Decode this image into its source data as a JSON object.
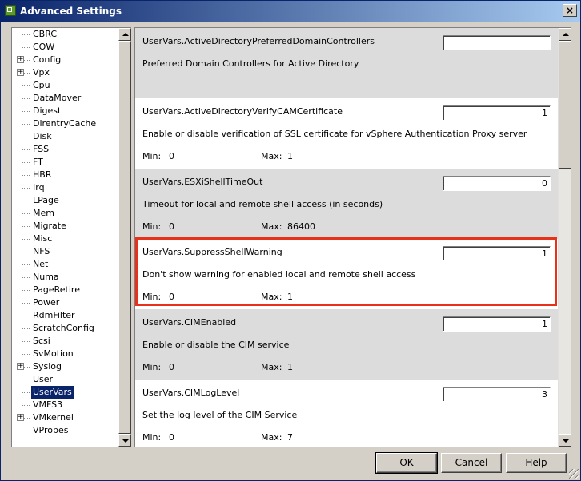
{
  "window": {
    "title": "Advanced Settings",
    "close_glyph": "×"
  },
  "tree": {
    "items": [
      {
        "label": "CBRC",
        "expandable": false
      },
      {
        "label": "COW",
        "expandable": false
      },
      {
        "label": "Config",
        "expandable": true
      },
      {
        "label": "Vpx",
        "expandable": true
      },
      {
        "label": "Cpu",
        "expandable": false
      },
      {
        "label": "DataMover",
        "expandable": false
      },
      {
        "label": "Digest",
        "expandable": false
      },
      {
        "label": "DirentryCache",
        "expandable": false
      },
      {
        "label": "Disk",
        "expandable": false
      },
      {
        "label": "FSS",
        "expandable": false
      },
      {
        "label": "FT",
        "expandable": false
      },
      {
        "label": "HBR",
        "expandable": false
      },
      {
        "label": "Irq",
        "expandable": false
      },
      {
        "label": "LPage",
        "expandable": false
      },
      {
        "label": "Mem",
        "expandable": false
      },
      {
        "label": "Migrate",
        "expandable": false
      },
      {
        "label": "Misc",
        "expandable": false
      },
      {
        "label": "NFS",
        "expandable": false
      },
      {
        "label": "Net",
        "expandable": false
      },
      {
        "label": "Numa",
        "expandable": false
      },
      {
        "label": "PageRetire",
        "expandable": false
      },
      {
        "label": "Power",
        "expandable": false
      },
      {
        "label": "RdmFilter",
        "expandable": false
      },
      {
        "label": "ScratchConfig",
        "expandable": false
      },
      {
        "label": "Scsi",
        "expandable": false
      },
      {
        "label": "SvMotion",
        "expandable": false
      },
      {
        "label": "Syslog",
        "expandable": true
      },
      {
        "label": "User",
        "expandable": false
      },
      {
        "label": "UserVars",
        "expandable": false,
        "selected": true
      },
      {
        "label": "VMFS3",
        "expandable": false
      },
      {
        "label": "VMkernel",
        "expandable": true
      },
      {
        "label": "VProbes",
        "expandable": false
      }
    ]
  },
  "settings": {
    "min_label": "Min:",
    "max_label": "Max:",
    "items": [
      {
        "name": "UserVars.ActiveDirectoryPreferredDomainControllers",
        "description": "Preferred Domain Controllers for Active Directory",
        "value": "",
        "min": "",
        "max": "",
        "show_range": false
      },
      {
        "name": "UserVars.ActiveDirectoryVerifyCAMCertificate",
        "description": "Enable or disable verification of SSL certificate for vSphere Authentication Proxy server",
        "value": "1",
        "min": "0",
        "max": "1",
        "show_range": true
      },
      {
        "name": "UserVars.ESXiShellTimeOut",
        "description": "Timeout for local and remote shell access (in seconds)",
        "value": "0",
        "min": "0",
        "max": "86400",
        "show_range": true
      },
      {
        "name": "UserVars.SuppressShellWarning",
        "description": "Don't show warning for enabled local and remote shell access",
        "value": "1",
        "min": "0",
        "max": "1",
        "show_range": true,
        "highlighted": true
      },
      {
        "name": "UserVars.CIMEnabled",
        "description": "Enable or disable the CIM service",
        "value": "1",
        "min": "0",
        "max": "1",
        "show_range": true
      },
      {
        "name": "UserVars.CIMLogLevel",
        "description": "Set the log level of the CIM Service",
        "value": "3",
        "min": "0",
        "max": "7",
        "show_range": true
      }
    ]
  },
  "buttons": {
    "ok": "OK",
    "cancel": "Cancel",
    "help": "Help"
  },
  "colors": {
    "highlight": "#e8311b",
    "selection": "#0a246a",
    "title_bar": "#0a246a"
  }
}
